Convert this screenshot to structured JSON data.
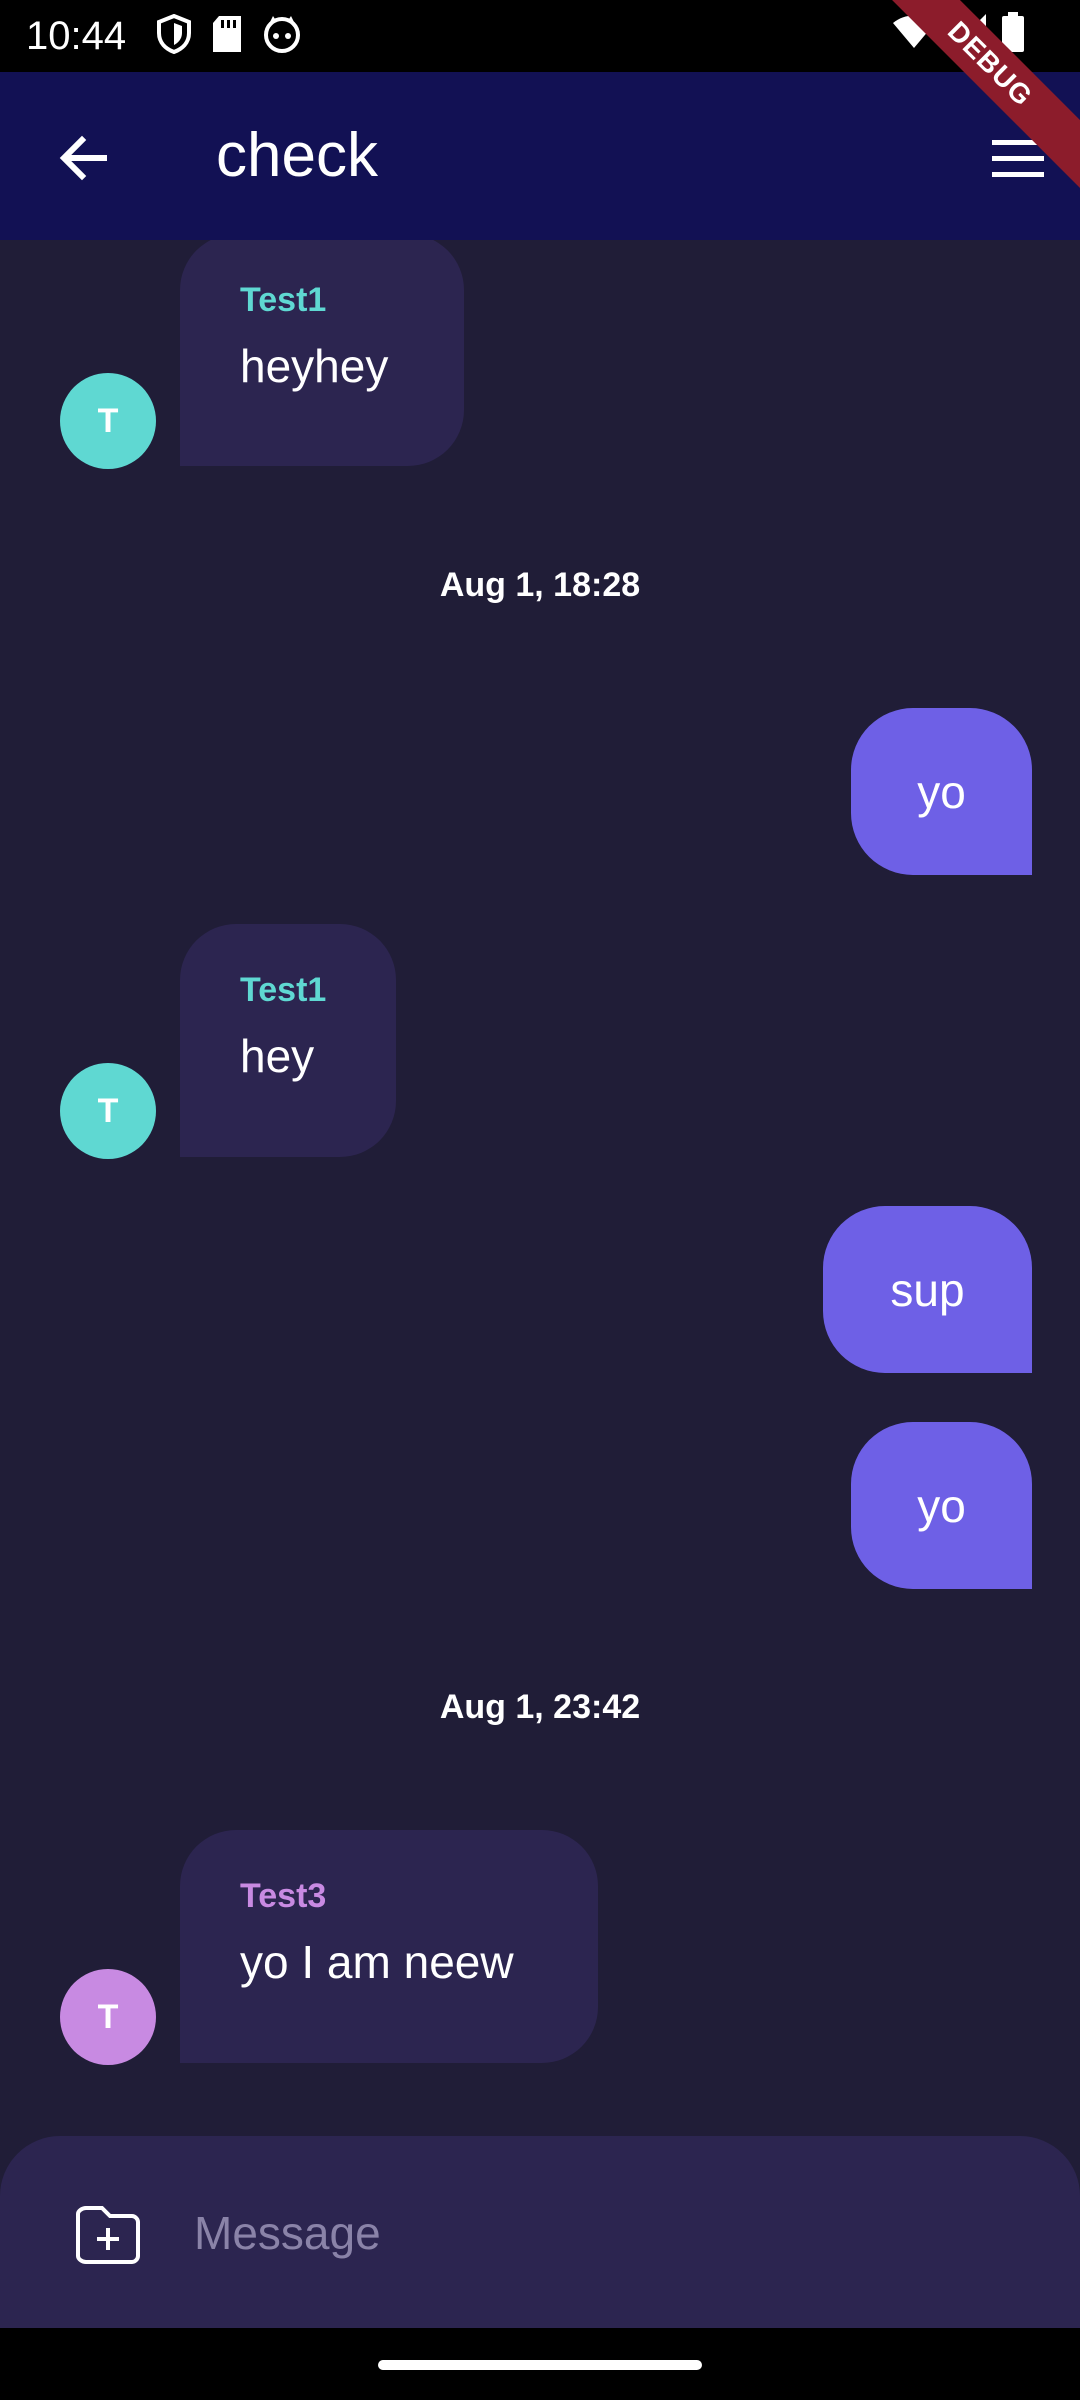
{
  "status": {
    "time": "10:44"
  },
  "appbar": {
    "title": "check"
  },
  "debug_banner": "DEBUG",
  "messages": [
    {
      "sender": "Test1",
      "text": "heyhey",
      "avatar": "T"
    },
    {
      "text": "yo"
    },
    {
      "sender": "Test1",
      "text": "hey",
      "avatar": "T"
    },
    {
      "text": "sup"
    },
    {
      "text": "yo"
    },
    {
      "sender": "Test3",
      "text": "yo I am neew",
      "avatar": "T"
    }
  ],
  "dates": [
    "Aug 1, 18:28",
    "Aug 1, 23:42"
  ],
  "composer": {
    "placeholder": "Message"
  },
  "colors": {
    "background": "#201d37",
    "appbar": "#121154",
    "incoming_bubble": "#2c2550",
    "outgoing_bubble": "#6e60e6",
    "test1": "#5fd8d2",
    "test3": "#c88ae2"
  }
}
